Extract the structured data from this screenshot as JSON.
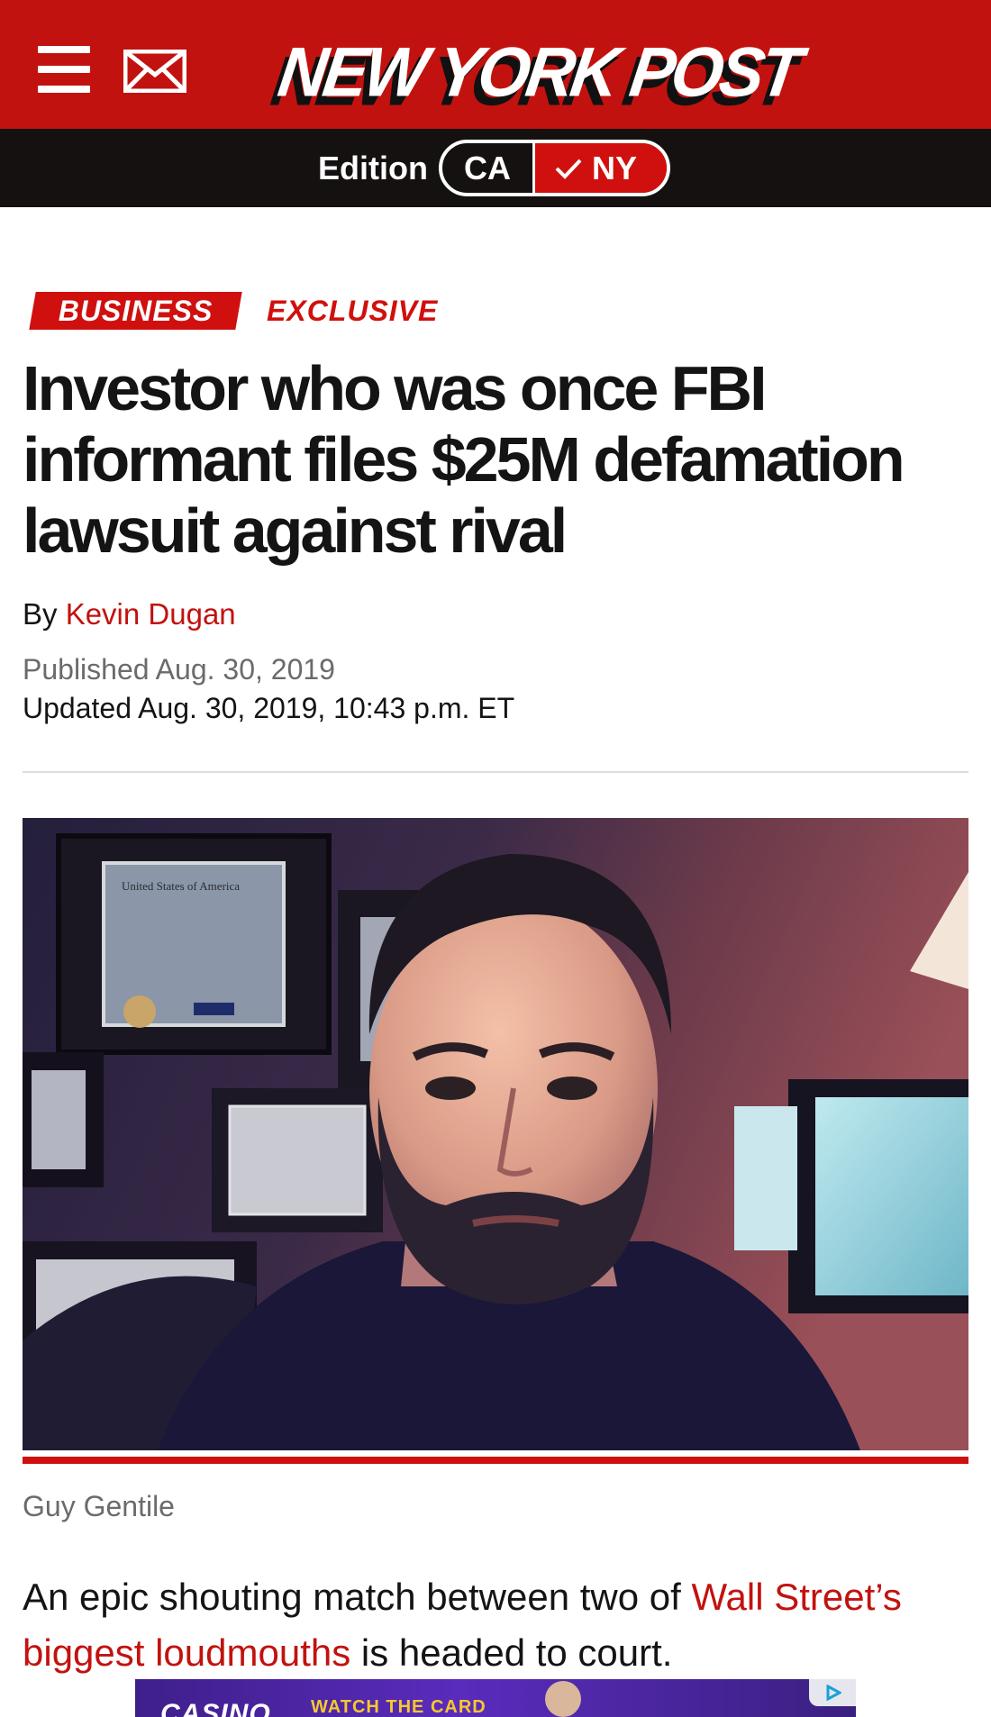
{
  "header": {
    "menu_icon": "hamburger-menu-icon",
    "mail_icon": "envelope-icon",
    "logo_text": "NEW YORK POST",
    "brand_color": "#c2120f"
  },
  "edition": {
    "label": "Edition",
    "options": [
      "CA",
      "NY"
    ],
    "selected": "NY",
    "selected_icon": "checkmark-icon"
  },
  "article": {
    "section": "BUSINESS",
    "tag": "EXCLUSIVE",
    "headline": "Investor who was once FBI informant files $25M defamation lawsuit against rival",
    "byline_prefix": "By",
    "author": "Kevin Dugan",
    "published": "Published Aug. 30, 2019",
    "updated": "Updated Aug. 30, 2019, 10:43 p.m. ET",
    "photo_caption": "Guy Gentile",
    "photo_certificate_text": "United States of America",
    "body": {
      "part1": "An epic shouting match between two of ",
      "link": "Wall Street’s biggest loudmouths",
      "part2": " is headed to court."
    }
  },
  "ad": {
    "brand": "CASINO",
    "cta": "WATCH THE CARD",
    "icon": "adchoices-icon"
  },
  "colors": {
    "accent": "#c2120f",
    "edition_bar": "#141110",
    "meta_gray": "#6b6b6b"
  }
}
